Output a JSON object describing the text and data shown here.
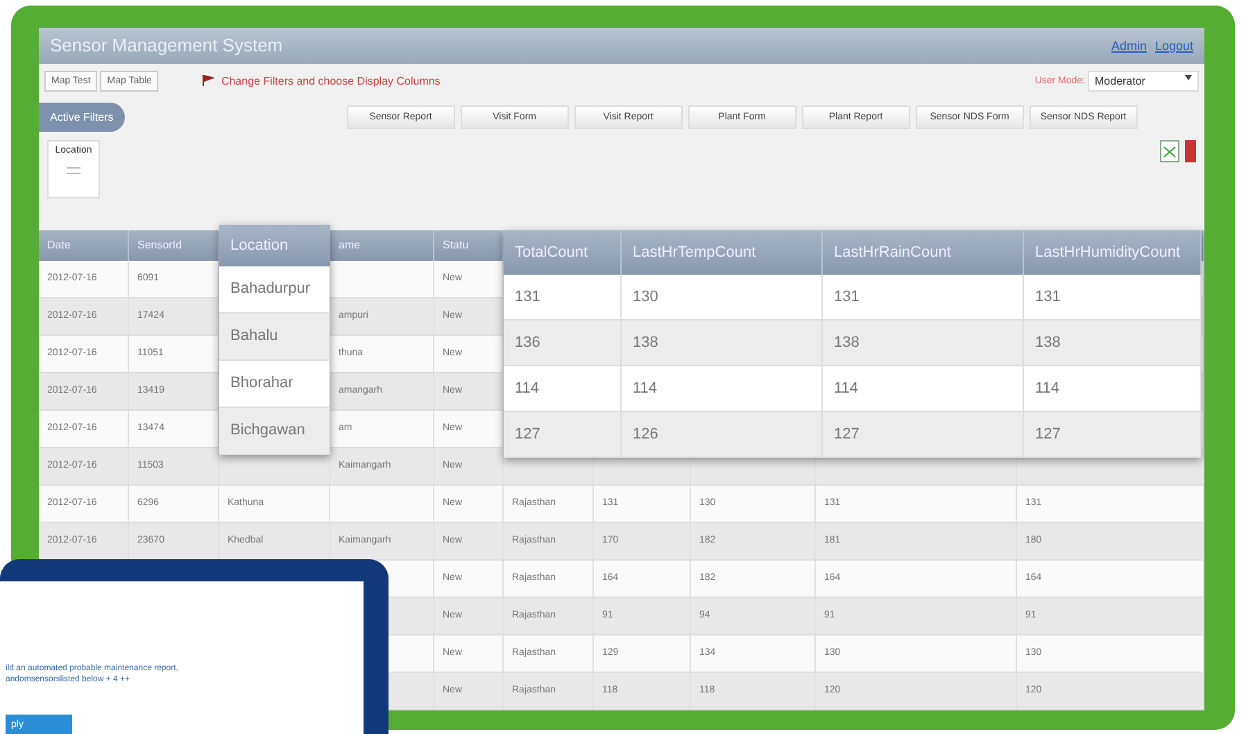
{
  "window": {
    "title": "Sensor Management System",
    "links": [
      "Admin",
      "Logout"
    ]
  },
  "toolbar": {
    "buttons": [
      "Map Test",
      "Map Table"
    ],
    "hint": "Change Filters and choose Display Columns",
    "user_mode_label": "User Mode:",
    "user_mode": "Moderator"
  },
  "filters_tab": {
    "label": "Active Filters",
    "selected": true
  },
  "actions": [
    "Sensor Report",
    "Visit Form",
    "Visit Report",
    "Plant Form",
    "Plant Report",
    "Sensor NDS Form",
    "Sensor NDS Report"
  ],
  "filter_box": {
    "label": "Location"
  },
  "table": {
    "columns": [
      "Date",
      "SensorId",
      null,
      "ame",
      "Statu",
      null,
      null,
      null,
      null,
      null
    ],
    "rows": [
      {
        "cells": [
          "2012-07-16",
          "6091",
          null,
          null,
          "New",
          null,
          null,
          null,
          null,
          null
        ]
      },
      {
        "cells": [
          "2012-07-16",
          "17424",
          null,
          "ampuri",
          "New",
          null,
          null,
          null,
          null,
          null
        ]
      },
      {
        "cells": [
          "2012-07-16",
          "11051",
          null,
          "thuna",
          "New",
          null,
          null,
          null,
          null,
          null
        ]
      },
      {
        "cells": [
          "2012-07-16",
          "13419",
          null,
          "amangarh",
          "New",
          null,
          null,
          null,
          null,
          null
        ]
      },
      {
        "cells": [
          "2012-07-16",
          "13474",
          null,
          "am",
          "New",
          null,
          null,
          null,
          null,
          null
        ]
      },
      {
        "cells": [
          "2012-07-16",
          "11503",
          null,
          "Kaimangarh",
          "New",
          null,
          null,
          null,
          null,
          null
        ]
      },
      {
        "cells": [
          "2012-07-16",
          "6296",
          "Kathuna",
          null,
          "New",
          "Rajasthan",
          "131",
          "130",
          "131",
          "131"
        ]
      },
      {
        "cells": [
          "2012-07-16",
          "23670",
          "Khedbal",
          "Kaimangarh",
          "New",
          "Rajasthan",
          "170",
          "182",
          "181",
          "180"
        ]
      },
      {
        "cells": [
          null,
          null,
          null,
          null,
          "New",
          "Rajasthan",
          "164",
          "182",
          "164",
          "164"
        ]
      },
      {
        "cells": [
          null,
          null,
          null,
          null,
          "New",
          "Rajasthan",
          "91",
          "94",
          "91",
          "91"
        ]
      },
      {
        "cells": [
          null,
          null,
          null,
          null,
          "New",
          "Rajasthan",
          "129",
          "134",
          "130",
          "130"
        ]
      },
      {
        "cells": [
          null,
          null,
          null,
          null,
          "New",
          "Rajasthan",
          "118",
          "118",
          "120",
          "120"
        ]
      }
    ]
  },
  "location_zoom": {
    "header": "Location",
    "items": [
      "Bahadurpur",
      "Bahalu",
      "Bhorahar",
      "Bichgawan"
    ]
  },
  "counts_zoom": {
    "columns": [
      "TotalCount",
      "LastHrTempCount",
      "LastHrRainCount",
      "LastHrHumidityCount"
    ],
    "rows": [
      [
        "131",
        "130",
        "131",
        "131"
      ],
      [
        "136",
        "138",
        "138",
        "138"
      ],
      [
        "114",
        "114",
        "114",
        "114"
      ],
      [
        "127",
        "126",
        "127",
        "127"
      ]
    ]
  },
  "popup": {
    "lines": [
      "ild an automated probable maintenance report,",
      "andomsensorslisted below + 4 ++"
    ],
    "button": "ply"
  }
}
